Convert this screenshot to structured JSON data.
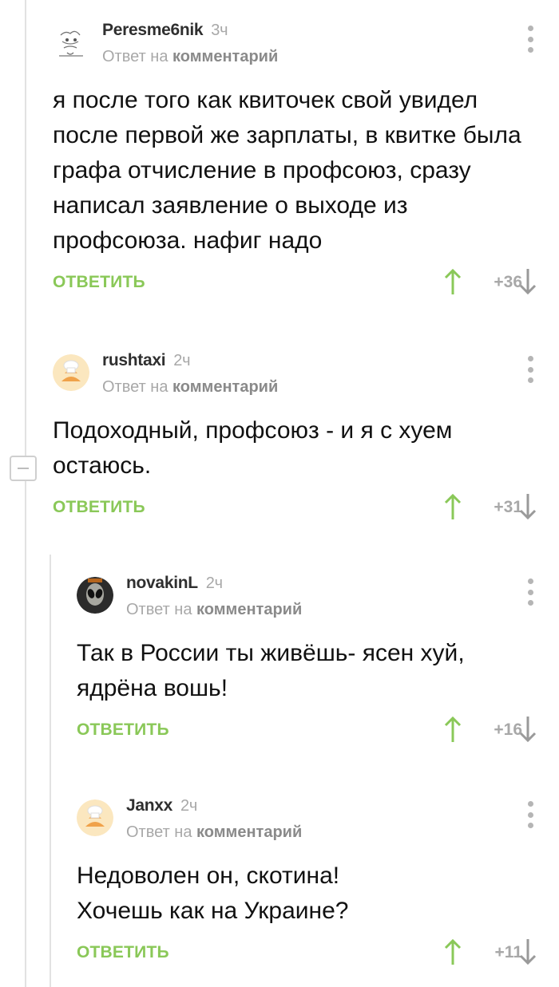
{
  "comments": [
    {
      "author": "Peresme6nik",
      "time": "3ч",
      "reply_prefix": "Ответ на",
      "reply_target": "комментарий",
      "text": "я после того как квиточек свой увидел после первой же зарплаты, в квитке была графа отчисление в профсоюз, сразу написал заявление о выходе из профсоюза. нафиг надо",
      "reply_label": "ОТВЕТИТЬ",
      "score": "+36",
      "avatar": "sketch-avatar"
    },
    {
      "author": "rushtaxi",
      "time": "2ч",
      "reply_prefix": "Ответ на",
      "reply_target": "комментарий",
      "text": "Подоходный, профсоюз - и я с хуем остаюсь.",
      "reply_label": "ОТВЕТИТЬ",
      "score": "+31",
      "avatar": "default-avatar"
    },
    {
      "author": "novakinL",
      "time": "2ч",
      "reply_prefix": "Ответ на",
      "reply_target": "комментарий",
      "text": "Так в России ты живёшь- ясен хуй, ядрёна вошь!",
      "reply_label": "ОТВЕТИТЬ",
      "score": "+16",
      "avatar": "alien-avatar"
    },
    {
      "author": "Janxx",
      "time": "2ч",
      "reply_prefix": "Ответ на",
      "reply_target": "комментарий",
      "text_lines": [
        "Недоволен он, скотина!",
        "Хочешь как на Украине?"
      ],
      "reply_label": "ОТВЕТИТЬ",
      "score": "+11",
      "avatar": "default-avatar"
    }
  ],
  "colors": {
    "reply_green": "#8ac858",
    "upvote_green": "#8ac858",
    "muted": "#a8a8a8",
    "thread_line": "#e2e2e2"
  },
  "icons": [
    "more-icon",
    "upvote-arrow-icon",
    "downvote-arrow-icon",
    "collapse-icon"
  ]
}
